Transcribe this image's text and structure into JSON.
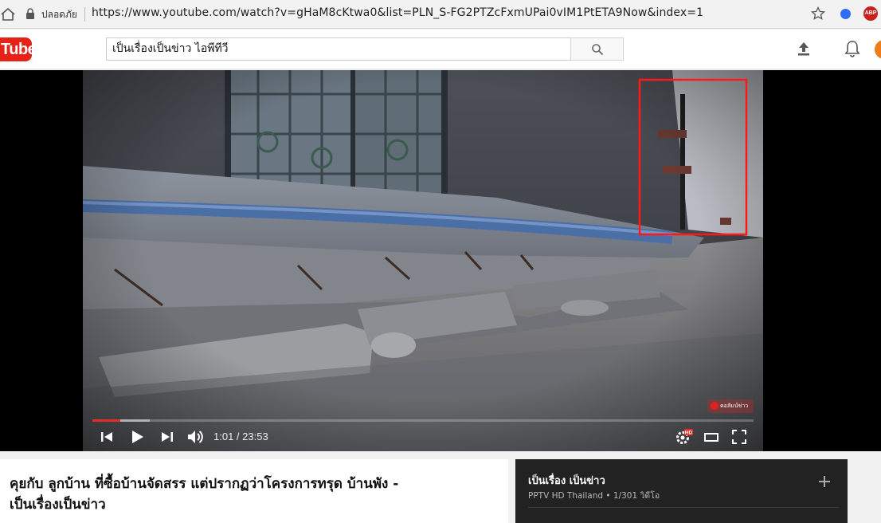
{
  "browser": {
    "secure_label": "ปลอดภัย",
    "url": "https://www.youtube.com/watch?v=gHaM8cKtwa0&list=PLN_S-FG2PTZcFxmUPai0vIM1PtETA9Now&index=1",
    "extension_abp_label": "ABP"
  },
  "masthead": {
    "logo_text": "Tube",
    "search_value": "เป็นเรื่องเป็นข่าว ไอพีทีวี"
  },
  "player": {
    "current_time": "1:01",
    "duration": "23:53",
    "time_display": "1:01 / 23:53",
    "progress_fraction": 0.0426,
    "buffered_fraction": 0.087,
    "quality_badge": "HD",
    "watermark_text": "คอลัมน์ข่าว"
  },
  "video": {
    "title": "คุยกับ ลูกบ้าน ที่ซื้อบ้านจัดสรร แต่ปรากฏว่าโครงการทรุด บ้านพัง - เป็นเรื่องเป็นข่าว"
  },
  "playlist": {
    "title": "เป็นเรื่อง เป็นข่าว",
    "meta": "PPTV HD Thailand • 1/301 วิดีโอ"
  },
  "colors": {
    "youtube_red": "#e62117",
    "progress_red": "#e52d27",
    "highlight_box": "#ff1a1a"
  }
}
